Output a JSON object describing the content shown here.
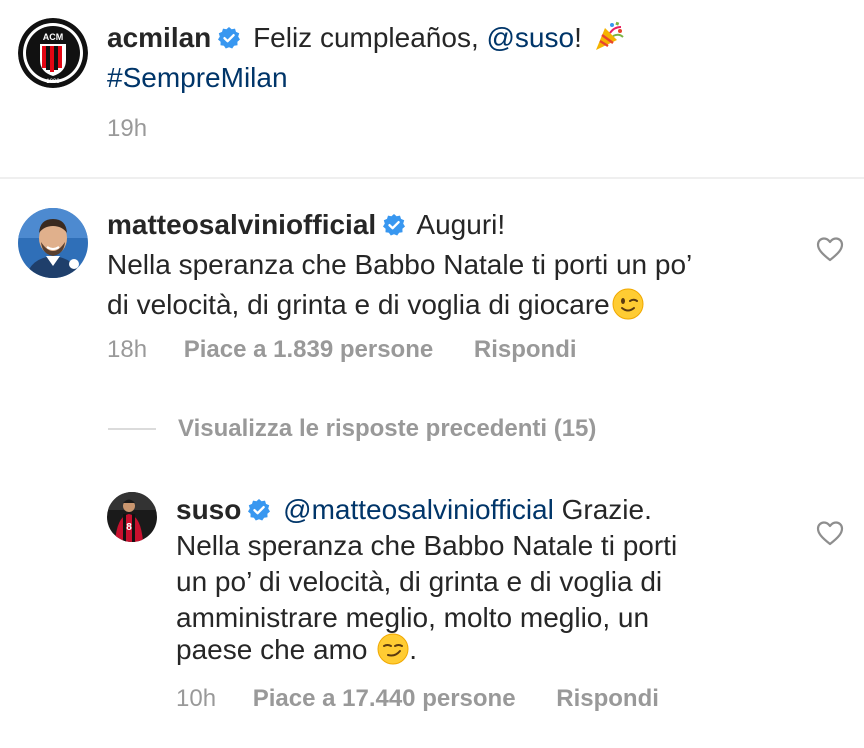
{
  "post": {
    "username": "acmilan",
    "text_1": "Feliz cumpleaños,",
    "mention": "@suso",
    "text_2": "!",
    "hashtag": "#SempreMilan",
    "time": "19h",
    "emoji_icon": "party-popper-icon",
    "avatar_icon": "ac-milan-crest-icon",
    "crest_text_top": "ACM",
    "crest_text_bottom": "1899"
  },
  "comment": {
    "username": "matteosalviniofficial",
    "line_1": "Auguri!",
    "line_2": "Nella speranza che Babbo Natale ti porti un po’",
    "line_3": "di velocità, di grinta e di voglia di giocare",
    "emoji_icon": "winking-face-icon",
    "time": "18h",
    "likes": "Piace a 1.839 persone",
    "reply": "Rispondi"
  },
  "view_replies": "Visualizza le risposte precedenti (15)",
  "reply": {
    "username": "suso",
    "mention": "@matteosalviniofficial",
    "line_1": "Grazie.",
    "line_2": "Nella speranza che Babbo Natale ti porti",
    "line_3": "un po’ di velocità, di grinta e di voglia di",
    "line_4": "amministrare meglio, molto meglio, un",
    "line_5": "paese che amo",
    "line_5_end": ".",
    "emoji_icon": "smirking-face-icon",
    "time": "10h",
    "likes": "Piace a 17.440 persone",
    "reply": "Rispondi"
  },
  "colors": {
    "link": "#003569",
    "verified": "#3897f0",
    "meta": "#999999",
    "milan_red": "#e30613"
  }
}
